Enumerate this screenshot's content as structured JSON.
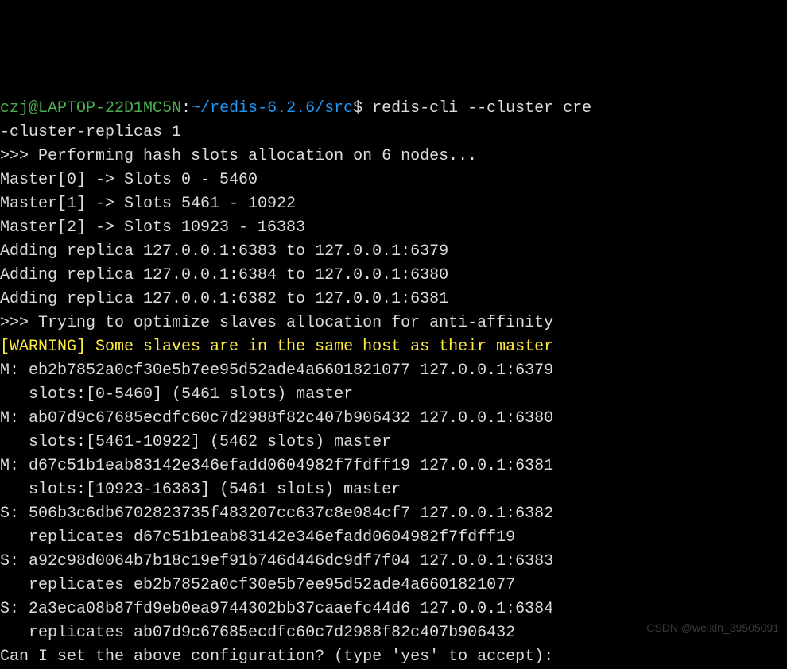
{
  "prompt": {
    "user_host": "czj@LAPTOP-22D1MC5N",
    "colon": ":",
    "path": "~/redis-6.2.6/src",
    "dollar": "$ ",
    "command": "redis-cli --cluster cre",
    "command_wrap": "-cluster-replicas 1"
  },
  "lines": {
    "l1": ">>> Performing hash slots allocation on 6 nodes...",
    "l2": "Master[0] -> Slots 0 - 5460",
    "l3": "Master[1] -> Slots 5461 - 10922",
    "l4": "Master[2] -> Slots 10923 - 16383",
    "l5": "Adding replica 127.0.0.1:6383 to 127.0.0.1:6379",
    "l6": "Adding replica 127.0.0.1:6384 to 127.0.0.1:6380",
    "l7": "Adding replica 127.0.0.1:6382 to 127.0.0.1:6381",
    "l8": ">>> Trying to optimize slaves allocation for anti-affinity",
    "l9": "[WARNING] Some slaves are in the same host as their master",
    "l10": "M: eb2b7852a0cf30e5b7ee95d52ade4a6601821077 127.0.0.1:6379",
    "l11": "   slots:[0-5460] (5461 slots) master",
    "l12": "M: ab07d9c67685ecdfc60c7d2988f82c407b906432 127.0.0.1:6380",
    "l13": "   slots:[5461-10922] (5462 slots) master",
    "l14": "M: d67c51b1eab83142e346efadd0604982f7fdff19 127.0.0.1:6381",
    "l15": "   slots:[10923-16383] (5461 slots) master",
    "l16": "S: 506b3c6db6702823735f483207cc637c8e084cf7 127.0.0.1:6382",
    "l17": "   replicates d67c51b1eab83142e346efadd0604982f7fdff19",
    "l18": "S: a92c98d0064b7b18c19ef91b746d446dc9df7f04 127.0.0.1:6383",
    "l19": "   replicates eb2b7852a0cf30e5b7ee95d52ade4a6601821077",
    "l20": "S: 2a3eca08b87fd9eb0ea9744302bb37caaefc44d6 127.0.0.1:6384",
    "l21": "   replicates ab07d9c67685ecdfc60c7d2988f82c407b906432",
    "l22": "Can I set the above configuration? (type 'yes' to accept): "
  },
  "watermark": "CSDN @weixin_39505091"
}
